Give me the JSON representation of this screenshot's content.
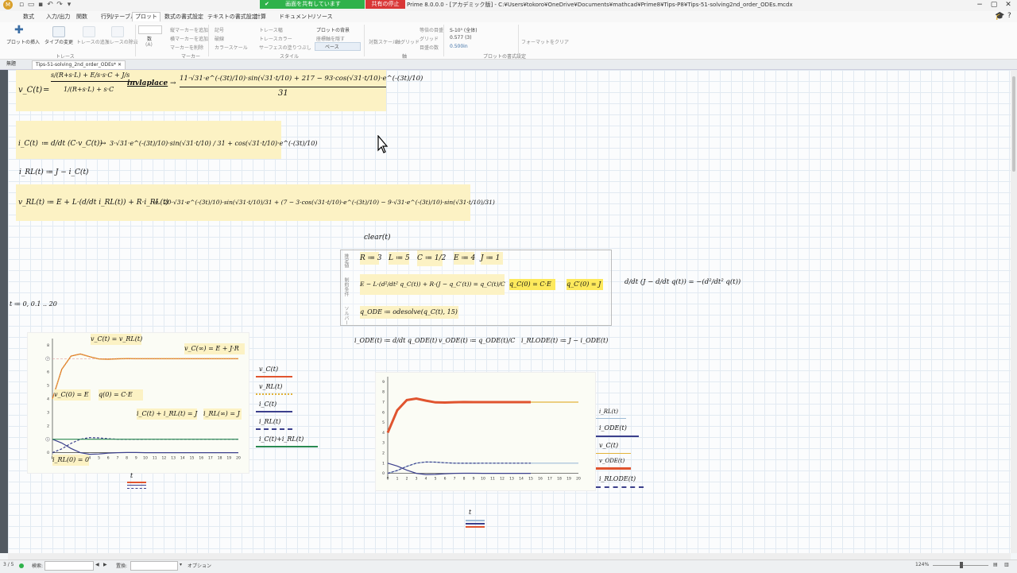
{
  "window": {
    "app_title": "Prime 8.0.0.0 - [アカデミック版] - C:¥Users¥tokoro¥OneDrive¥Documents¥mathcad¥Prime8¥Tips-P8¥Tips-51-solving2nd_order_ODEs.mcdx",
    "sharing_label": "画面を共有しています",
    "stop_sharing_label": "共有の停止"
  },
  "menu": [
    "数式",
    "入力/出力",
    "関数",
    "行列/テーブル",
    "プロット",
    "数式の書式設定",
    "テキストの書式設定",
    "計算",
    "ドキュメント",
    "リソース"
  ],
  "active_menu": "プロット",
  "ribbon": {
    "trace": {
      "insert_plot": "プロットの挿入",
      "change_type": "タイプの変更",
      "add_trace": "トレースの追加",
      "delete_trace": "トレースの除去",
      "group_label": "トレース"
    },
    "markers": {
      "count_label": "数",
      "count_value": "(A)",
      "add_vertical": "縦マーカーを追加",
      "add_horizontal": "横マーカーを追加",
      "delete_marker": "マーカーを削除",
      "group_label": "マーカー"
    },
    "style": {
      "symbol": "記号",
      "dashed": "破線",
      "color_scale": "カラースケール",
      "trace_width": "トレース幅",
      "trace_color": "トレースカラー",
      "surface_fill": "サーフェスの塗りつぶし",
      "plot_bg": "プロットの背景",
      "hide_axes": "座標軸を隠す",
      "base": "ベース",
      "group_label": "スタイル"
    },
    "axes": {
      "scale": "対数スケール",
      "grid": "軸グリッド",
      "equal_scale": "等倍の目盛",
      "show_grid": "グリッド",
      "numbering": "目盛の数",
      "group_label": "軸"
    },
    "format": {
      "unit": "S-10⁵ (全体)",
      "value": "0.577 (3)",
      "size": "0.500in",
      "clear": "フォーマットをクリア",
      "group_label": "プロットの書式設定"
    }
  },
  "doc_tabs": [
    "無題",
    "Tips-51-solving_2nd_order_ODEs*"
  ],
  "worksheet": {
    "eq1": {
      "lhs": "v_C(t)",
      "op": "invlaplace",
      "result_main": "11·√31·e^(-(3t)/10)·sin(√31·t/10) + 217 − 93·cos(√31·t/10)·e^(-(3t)/10)",
      "denom": "31"
    },
    "eq2": {
      "lhs": "i_C(t)",
      "rhs": "d/dt (C·v_C(t))",
      "result": "3·√31·e^(-(3t)/10)·sin(√31·t/10) / 31 + cos(√31·t/10)·e^(-(3t)/10)"
    },
    "eq3": "i_RL(t) ≔ J − i_C(t)",
    "eq4": {
      "lhs": "v_RL(t) ≔ E + L·(d/dt i_RL(t)) + R·i_RL(t)",
      "result": "20·√31·e^(-(3t)/10)·sin(√31·t/10)/31 + (7 − 3·cos(√31·t/10)·e^(-(3t)/10) − 9·√31·e^(-(3t)/10)·sin(√31·t/10)/31)"
    },
    "range": "t ≔ 0, 0.1 .. 20",
    "clear": "clear(t)",
    "params": [
      "R ≔ 3",
      "L ≔ 5",
      "C ≔ 1/2",
      "E ≔ 4",
      "J ≔ 1"
    ],
    "ode": "E − L·(d²/dt² q_C(t)) + R·(J − q_C′(t)) = q_C(t)/C",
    "ic1": "q_C(0) = C·E",
    "ic2": "q_C′(0) = J",
    "aside": "d/dt (J − d/dt q(t)) = −(d²/dt² q(t))",
    "solver": "q_ODE ≔ odesolve(q_C(t), 15)",
    "solve_box_labels": [
      "ソルバー",
      "制約条件",
      "推定値"
    ],
    "defs": [
      "i_ODE(t) ≔ d/dt q_ODE(t)",
      "v_ODE(t) ≔ q_ODE(t)/C",
      "i_RLODE(t) ≔ J − i_ODE(t)"
    ],
    "notes": [
      "v_C(t) = v_RL(t)",
      "v_C(∞) = E + J·R",
      "v_C(0) = E",
      "q(0) = C·E",
      "i_C(t) + i_RL(t) = J",
      "i_RL(∞) = J",
      "i_RL(0) = 0"
    ]
  },
  "chart_data": [
    {
      "type": "line",
      "xlabel": "t",
      "xlim": [
        0,
        20
      ],
      "x_ticks": [
        "0",
        "1",
        "2",
        "3",
        "4",
        "5",
        "6",
        "7",
        "8",
        "9",
        "10",
        "11",
        "12",
        "13",
        "14",
        "15",
        "16",
        "17",
        "18",
        "19",
        "20"
      ],
      "ylim": [
        -0.5,
        8.5
      ],
      "y_ticks": [
        "8",
        "7",
        "6",
        "5",
        "4",
        "3",
        "2",
        "1",
        "0"
      ],
      "x": [
        0,
        1,
        2,
        3,
        4,
        5,
        6,
        7,
        8,
        9,
        10,
        11,
        12,
        13,
        14,
        15,
        16,
        17,
        18,
        19,
        20
      ],
      "series": [
        {
          "name": "v_C(t)",
          "color": "#e0542f",
          "style": "solid",
          "values": [
            4.0,
            6.2,
            7.2,
            7.35,
            7.15,
            6.98,
            6.96,
            6.99,
            7.01,
            7.0,
            7.0,
            7.0,
            7.0,
            7.0,
            7.0,
            7.0,
            7.0,
            7.0,
            7.0,
            7.0,
            7.0
          ]
        },
        {
          "name": "v_RL(t)",
          "color": "#e2b33a",
          "style": "dotted",
          "values": [
            4.0,
            6.2,
            7.2,
            7.35,
            7.15,
            6.98,
            6.96,
            6.99,
            7.01,
            7.0,
            7.0,
            7.0,
            7.0,
            7.0,
            7.0,
            7.0,
            7.0,
            7.0,
            7.0,
            7.0,
            7.0
          ]
        },
        {
          "name": "i_C(t)",
          "color": "#3b3f8c",
          "style": "solid",
          "values": [
            1.0,
            0.72,
            0.31,
            0.0,
            -0.12,
            -0.1,
            -0.04,
            0.0,
            0.01,
            0.01,
            0.0,
            0.0,
            0.0,
            0.0,
            0.0,
            0.0,
            0.0,
            0.0,
            0.0,
            0.0,
            0.0
          ]
        },
        {
          "name": "i_RL(t)",
          "color": "#3b3f8c",
          "style": "dashed",
          "values": [
            0.0,
            0.28,
            0.69,
            1.0,
            1.12,
            1.1,
            1.04,
            1.0,
            0.99,
            0.99,
            1.0,
            1.0,
            1.0,
            1.0,
            1.0,
            1.0,
            1.0,
            1.0,
            1.0,
            1.0,
            1.0
          ]
        },
        {
          "name": "i_C(t)+i_RL(t)",
          "color": "#2a8a52",
          "style": "solid",
          "values": [
            1,
            1,
            1,
            1,
            1,
            1,
            1,
            1,
            1,
            1,
            1,
            1,
            1,
            1,
            1,
            1,
            1,
            1,
            1,
            1,
            1
          ]
        }
      ],
      "markers": [
        {
          "axis": "y",
          "value": 7,
          "label": "7"
        },
        {
          "axis": "y",
          "value": 1,
          "label": "1"
        }
      ]
    },
    {
      "type": "line",
      "xlabel": "t",
      "xlim": [
        0,
        20
      ],
      "x_ticks": [
        "0",
        "1",
        "2",
        "3",
        "4",
        "5",
        "6",
        "7",
        "8",
        "9",
        "10",
        "11",
        "12",
        "13",
        "14",
        "15",
        "16",
        "17",
        "18",
        "19",
        "20"
      ],
      "ylim": [
        -0.5,
        9.5
      ],
      "y_ticks": [
        "9",
        "8",
        "7",
        "6",
        "5",
        "4",
        "3",
        "2",
        "1",
        "0"
      ],
      "x": [
        0,
        1,
        2,
        3,
        4,
        5,
        6,
        7,
        8,
        9,
        10,
        11,
        12,
        13,
        14,
        15,
        16,
        17,
        18,
        19,
        20
      ],
      "series": [
        {
          "name": "i_RL(t)",
          "color": "#9fbcd6",
          "style": "solid",
          "values": [
            0.0,
            0.28,
            0.69,
            1.0,
            1.12,
            1.1,
            1.04,
            1.0,
            0.99,
            0.99,
            1.0,
            1.0,
            1.0,
            1.0,
            1.0,
            1.0,
            1.0,
            1.0,
            1.0,
            1.0,
            1.0
          ]
        },
        {
          "name": "i_ODE(t)",
          "color": "#3b3f8c",
          "style": "solid",
          "values": [
            1.0,
            0.72,
            0.31,
            0.0,
            -0.12,
            -0.1,
            -0.04,
            0.0,
            0.01,
            0.01,
            0.0,
            0.0,
            0.0,
            0.0,
            0.0,
            0.0
          ]
        },
        {
          "name": "v_C(t)",
          "color": "#e2b33a",
          "style": "solid",
          "values": [
            4.0,
            6.2,
            7.2,
            7.35,
            7.15,
            6.98,
            6.96,
            6.99,
            7.01,
            7.0,
            7.0,
            7.0,
            7.0,
            7.0,
            7.0,
            7.0,
            7.0,
            7.0,
            7.0,
            7.0,
            7.0
          ]
        },
        {
          "name": "v_ODE(t)",
          "color": "#e0542f",
          "style": "solid-thick",
          "values": [
            4.0,
            6.2,
            7.2,
            7.35,
            7.15,
            6.98,
            6.96,
            6.99,
            7.01,
            7.0,
            7.0,
            7.0,
            7.0,
            7.0,
            7.0,
            7.0
          ]
        },
        {
          "name": "i_RLODE(t)",
          "color": "#3b3f8c",
          "style": "dashed",
          "values": [
            0.0,
            0.28,
            0.69,
            1.0,
            1.12,
            1.1,
            1.04,
            1.0,
            0.99,
            0.99,
            1.0,
            1.0,
            1.0,
            1.0,
            1.0,
            1.0
          ]
        }
      ]
    }
  ],
  "statusbar": {
    "page": "3 / 5",
    "search_label": "検索:",
    "replace_label": "置換:",
    "options_label": "オプション",
    "zoom": "124%"
  }
}
